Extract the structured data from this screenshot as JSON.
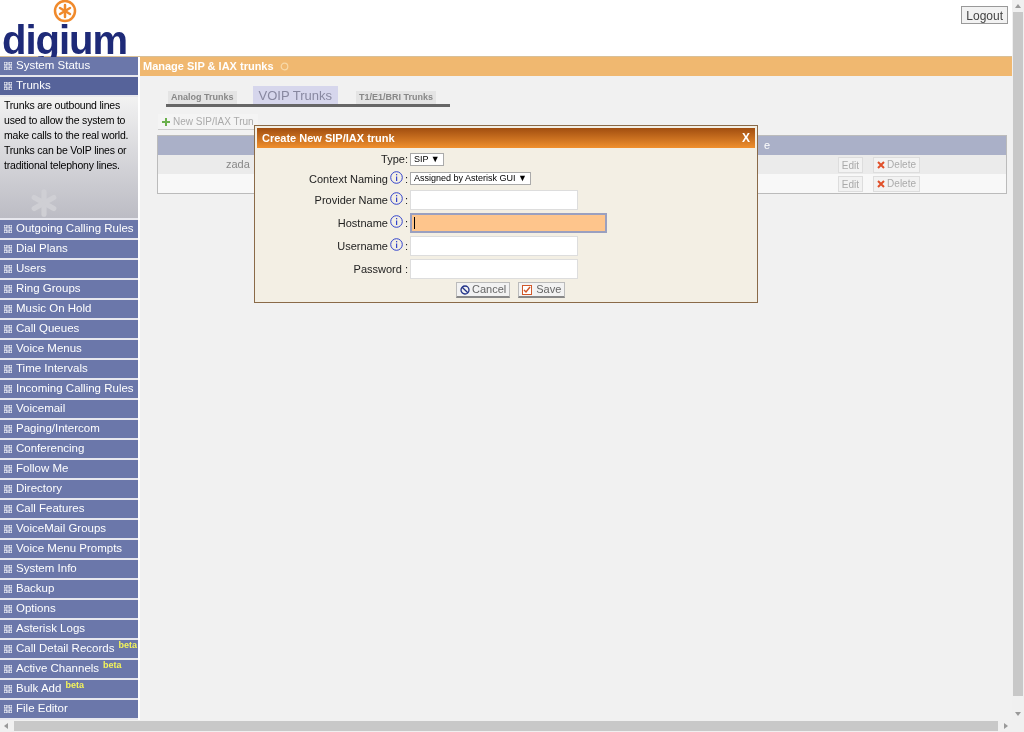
{
  "header": {
    "logo_text": "digium",
    "logout": "Logout"
  },
  "sidebar": {
    "items": [
      {
        "label": "System Status",
        "selected": false
      },
      {
        "label": "Trunks",
        "selected": true,
        "description": "Trunks are outbound lines used to allow the system to make calls to the real world. Trunks can be VoIP lines or traditional telephony lines."
      },
      {
        "label": "Outgoing Calling Rules",
        "selected": false
      },
      {
        "label": "Dial Plans",
        "selected": false
      },
      {
        "label": "Users",
        "selected": false
      },
      {
        "label": "Ring Groups",
        "selected": false
      },
      {
        "label": "Music On Hold",
        "selected": false
      },
      {
        "label": "Call Queues",
        "selected": false
      },
      {
        "label": "Voice Menus",
        "selected": false
      },
      {
        "label": "Time Intervals",
        "selected": false
      },
      {
        "label": "Incoming Calling Rules",
        "selected": false
      },
      {
        "label": "Voicemail",
        "selected": false
      },
      {
        "label": "Paging/Intercom",
        "selected": false
      },
      {
        "label": "Conferencing",
        "selected": false
      },
      {
        "label": "Follow Me",
        "selected": false
      },
      {
        "label": "Directory",
        "selected": false
      },
      {
        "label": "Call Features",
        "selected": false
      },
      {
        "label": "VoiceMail Groups",
        "selected": false
      },
      {
        "label": "Voice Menu Prompts",
        "selected": false
      },
      {
        "label": "System Info",
        "selected": false
      },
      {
        "label": "Backup",
        "selected": false
      },
      {
        "label": "Options",
        "selected": false
      },
      {
        "label": "Asterisk Logs",
        "selected": false
      },
      {
        "label": "Call Detail Records",
        "selected": false,
        "badge": "beta"
      },
      {
        "label": "Active Channels",
        "selected": false,
        "badge": "beta"
      },
      {
        "label": "Bulk Add",
        "selected": false,
        "badge": "beta"
      },
      {
        "label": "File Editor",
        "selected": false
      }
    ]
  },
  "main": {
    "title": "Manage SIP & IAX trunks",
    "tabs": [
      {
        "label": "Analog Trunks",
        "selected": false
      },
      {
        "label": "VOIP Trunks",
        "selected": true
      },
      {
        "label": "T1/E1/BRI Trunks",
        "selected": false
      }
    ],
    "new_button": "New SIP/IAX Trun",
    "table": {
      "header": "e",
      "rows": [
        {
          "cell": "zada",
          "edit": "Edit",
          "delete": "Delete"
        },
        {
          "edit": "Edit",
          "delete": "Delete"
        }
      ]
    }
  },
  "dialog": {
    "title": "Create New SIP/IAX trunk",
    "close": "X",
    "fields": [
      {
        "kind": "select",
        "label": "Type:",
        "info": false,
        "value": "SIP ▼"
      },
      {
        "kind": "select",
        "label": "Context Naming",
        "info": true,
        "suffix": ":",
        "value": "Assigned by Asterisk GUI ▼"
      },
      {
        "kind": "text",
        "label": "Provider Name",
        "info": true,
        "suffix": ":",
        "focused": false
      },
      {
        "kind": "text",
        "label": "Hostname",
        "info": true,
        "suffix": ":",
        "focused": true
      },
      {
        "kind": "text",
        "label": "Username",
        "info": true,
        "suffix": ":",
        "focused": false
      },
      {
        "kind": "text",
        "label": "Password :",
        "info": false,
        "focused": false
      }
    ],
    "cancel": "Cancel",
    "save": "Save"
  }
}
